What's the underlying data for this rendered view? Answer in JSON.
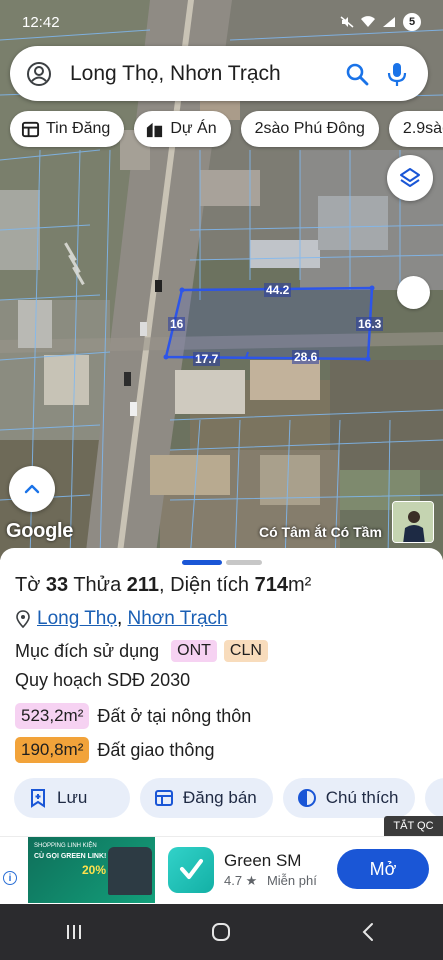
{
  "status_bar": {
    "time": "12:42",
    "battery": "5"
  },
  "search": {
    "query": "Long Thọ, Nhơn Trạch"
  },
  "chips": [
    {
      "label": "Tin Đăng",
      "icon": "listing-icon"
    },
    {
      "label": "Dự Án",
      "icon": "building-icon"
    },
    {
      "label": "2sào Phú Đông",
      "icon": ""
    },
    {
      "label": "2.9sào",
      "icon": ""
    }
  ],
  "map": {
    "parcel_dimensions": {
      "top": "44.2",
      "left": "16",
      "right": "16.3",
      "bottom_left": "17.7",
      "bottom_right": "28.6"
    },
    "watermark": "Google",
    "attribution": "Có Tâm ắt Có Tầm",
    "parcel_color": "#2d55e8"
  },
  "sheet": {
    "title_parts": {
      "p1": "Tờ ",
      "sheet": "33",
      "p2": " Thửa ",
      "plot": "211",
      "p3": ", Diện tích ",
      "area": "714",
      "unit": "m²"
    },
    "location": {
      "commune": "Long Thọ",
      "sep": ", ",
      "district": "Nhơn Trạch"
    },
    "usage_label": "Mục đích sử dụng",
    "usage_tags": [
      {
        "code": "ONT",
        "color": "#f6d2f2"
      },
      {
        "code": "CLN",
        "color": "#f8dcbc"
      }
    ],
    "plan_label": "Quy hoạch SDĐ 2030",
    "plan_items": [
      {
        "area": "523,2m²",
        "label": "Đất ở tại nông thôn",
        "color": "#f6d2f2"
      },
      {
        "area": "190,8m²",
        "label": "Đất giao thông",
        "color": "#f2a33a"
      }
    ],
    "actions": [
      {
        "label": "Lưu",
        "icon": "bookmark-add-icon"
      },
      {
        "label": "Đăng bán",
        "icon": "listing-icon"
      },
      {
        "label": "Chú thích",
        "icon": "legend-icon"
      }
    ],
    "close_ads_label": "TẮT QC"
  },
  "ad": {
    "banner_line1": "SHOPPING LINH KIỆN",
    "banner_line2": "CÙ GỌI GREEN LINK!",
    "banner_percent": "20%",
    "app_name": "Green SM",
    "rating": "4.7 ★",
    "price": "Miễn phí",
    "cta": "Mở"
  }
}
